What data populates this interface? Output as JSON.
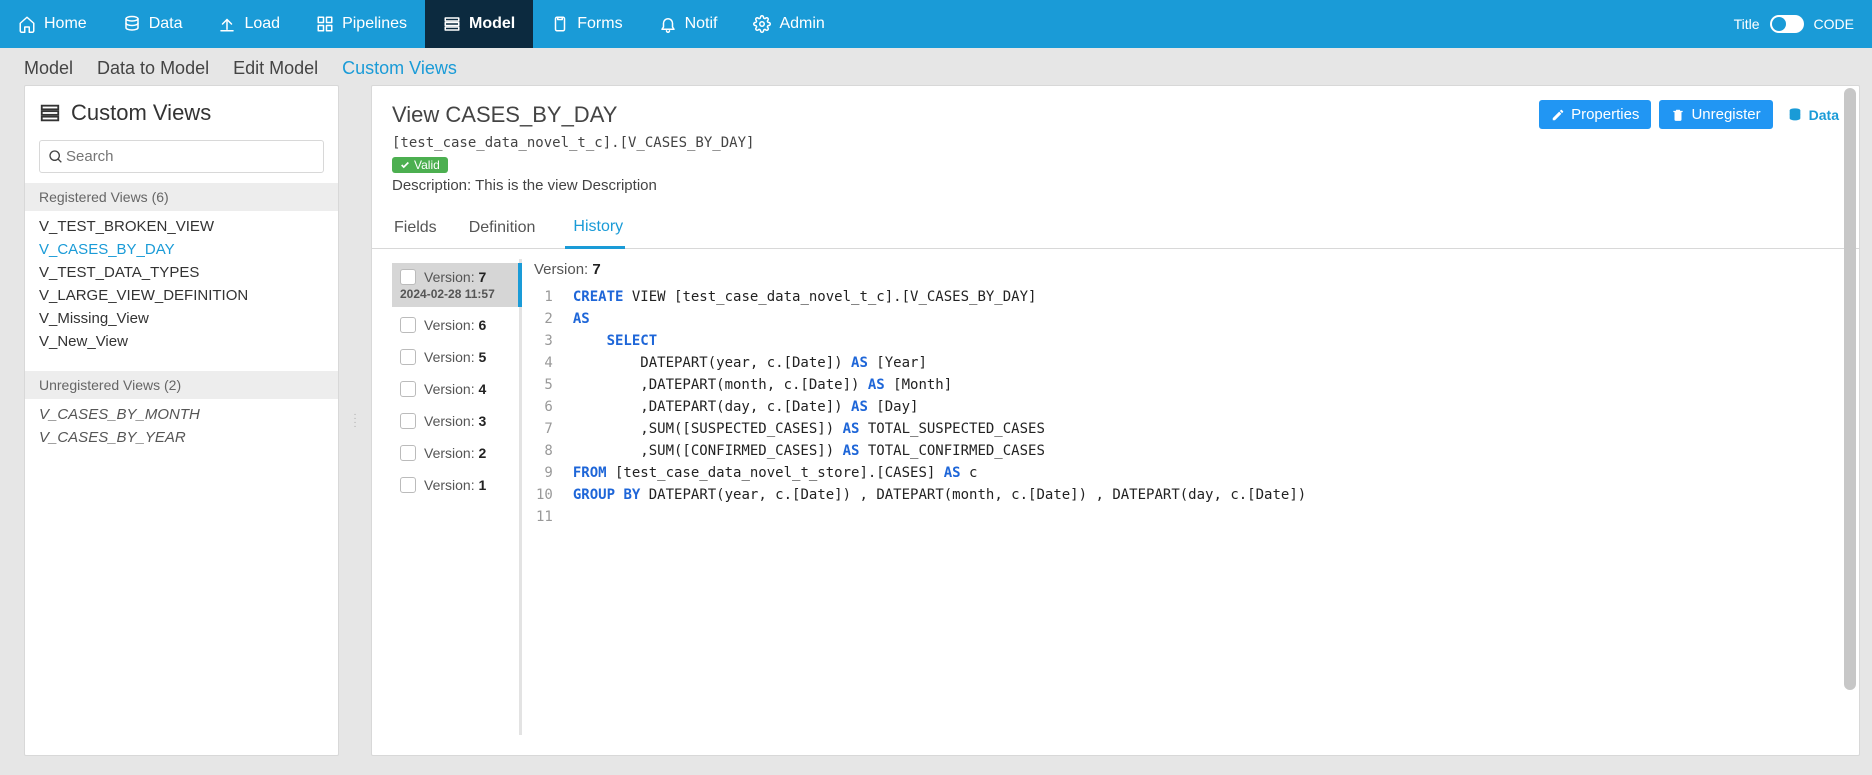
{
  "navbar": {
    "items": [
      {
        "icon": "home",
        "label": "Home"
      },
      {
        "icon": "database",
        "label": "Data"
      },
      {
        "icon": "upload",
        "label": "Load"
      },
      {
        "icon": "pipeline",
        "label": "Pipelines"
      },
      {
        "icon": "model",
        "label": "Model",
        "active": true
      },
      {
        "icon": "clipboard",
        "label": "Forms"
      },
      {
        "icon": "bell",
        "label": "Notif"
      },
      {
        "icon": "gear",
        "label": "Admin"
      }
    ],
    "right": {
      "title_label": "Title",
      "code_label": "CODE"
    }
  },
  "subnav": {
    "items": [
      {
        "label": "Model"
      },
      {
        "label": "Data to Model"
      },
      {
        "label": "Edit Model"
      },
      {
        "label": "Custom Views",
        "active": true
      }
    ]
  },
  "sidebar": {
    "title": "Custom Views",
    "search_placeholder": "Search",
    "registered_header": "Registered Views (6)",
    "registered": [
      "V_TEST_BROKEN_VIEW",
      "V_CASES_BY_DAY",
      "V_TEST_DATA_TYPES",
      "V_LARGE_VIEW_DEFINITION",
      "V_Missing_View",
      "V_New_View"
    ],
    "registered_active_index": 1,
    "unregistered_header": "Unregistered Views (2)",
    "unregistered": [
      "V_CASES_BY_MONTH",
      "V_CASES_BY_YEAR"
    ]
  },
  "view": {
    "title": "View CASES_BY_DAY",
    "fq_name": "[test_case_data_novel_t_c].[V_CASES_BY_DAY]",
    "valid_label": "Valid",
    "description_label": "Description:",
    "description": "This is the view Description",
    "properties_btn": "Properties",
    "unregister_btn": "Unregister",
    "data_link": "Data"
  },
  "tabs": {
    "items": [
      {
        "label": "Fields"
      },
      {
        "label": "Definition"
      },
      {
        "label": "History",
        "icon": "history",
        "active": true
      }
    ]
  },
  "history": {
    "versions": [
      {
        "num": "7",
        "date": "2024-02-28 11:57",
        "active": true
      },
      {
        "num": "6"
      },
      {
        "num": "5"
      },
      {
        "num": "4"
      },
      {
        "num": "3"
      },
      {
        "num": "2"
      },
      {
        "num": "1"
      }
    ],
    "version_label": "Version:",
    "current_version": "7",
    "sql_lines": [
      [
        {
          "t": "CREATE",
          "kw": true
        },
        {
          "t": " VIEW [test_case_data_novel_t_c].[V_CASES_BY_DAY]"
        }
      ],
      [
        {
          "t": "AS",
          "kw": true
        }
      ],
      [
        {
          "t": "    "
        },
        {
          "t": "SELECT",
          "kw": true
        }
      ],
      [
        {
          "t": "        DATEPART(year, c.[Date]) "
        },
        {
          "t": "AS",
          "kw": true
        },
        {
          "t": " [Year]"
        }
      ],
      [
        {
          "t": "        ,DATEPART(month, c.[Date]) "
        },
        {
          "t": "AS",
          "kw": true
        },
        {
          "t": " [Month]"
        }
      ],
      [
        {
          "t": "        ,DATEPART(day, c.[Date]) "
        },
        {
          "t": "AS",
          "kw": true
        },
        {
          "t": " [Day]"
        }
      ],
      [
        {
          "t": "        ,SUM([SUSPECTED_CASES]) "
        },
        {
          "t": "AS",
          "kw": true
        },
        {
          "t": " TOTAL_SUSPECTED_CASES"
        }
      ],
      [
        {
          "t": "        ,SUM([CONFIRMED_CASES]) "
        },
        {
          "t": "AS",
          "kw": true
        },
        {
          "t": " TOTAL_CONFIRMED_CASES"
        }
      ],
      [
        {
          "t": "FROM",
          "kw": true
        },
        {
          "t": " [test_case_data_novel_t_store].[CASES] "
        },
        {
          "t": "AS",
          "kw": true
        },
        {
          "t": " c"
        }
      ],
      [
        {
          "t": "GROUP",
          "kw": true
        },
        {
          "t": " "
        },
        {
          "t": "BY",
          "kw": true
        },
        {
          "t": " DATEPART(year, c.[Date]) , DATEPART(month, c.[Date]) , DATEPART(day, c.[Date])"
        }
      ],
      [
        {
          "t": ""
        }
      ]
    ]
  }
}
